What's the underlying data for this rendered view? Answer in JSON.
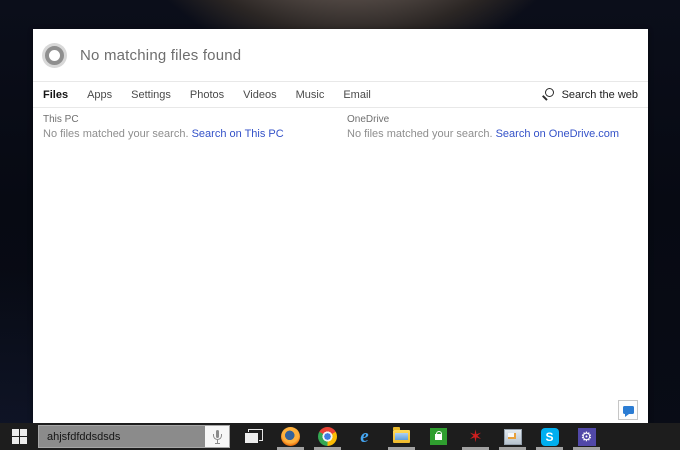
{
  "search_panel": {
    "status_text": "No matching files found",
    "tabs": [
      {
        "label": "Files",
        "active": true
      },
      {
        "label": "Apps",
        "active": false
      },
      {
        "label": "Settings",
        "active": false
      },
      {
        "label": "Photos",
        "active": false
      },
      {
        "label": "Videos",
        "active": false
      },
      {
        "label": "Music",
        "active": false
      },
      {
        "label": "Email",
        "active": false
      }
    ],
    "web_search_label": "Search the web",
    "result_groups": [
      {
        "source": "This PC",
        "message": "No files matched your search.",
        "link_label": "Search on This PC"
      },
      {
        "source": "OneDrive",
        "message": "No files matched your search.",
        "link_label": "Search on OneDrive.com"
      }
    ],
    "icons": {
      "cortana": "cortana-ring-icon",
      "web_search": "magnifier-icon",
      "feedback": "feedback-bubble-icon"
    }
  },
  "taskbar": {
    "search": {
      "value": "ahjsfdfddsdsds"
    },
    "start_icon": "windows-logo-icon",
    "mic_icon": "microphone-icon",
    "icons": [
      {
        "name": "task-view-icon",
        "running": false
      },
      {
        "name": "firefox-icon",
        "running": true
      },
      {
        "name": "chrome-icon",
        "running": true
      },
      {
        "name": "internet-explorer-icon",
        "glyph": "e",
        "running": false
      },
      {
        "name": "file-explorer-icon",
        "running": true
      },
      {
        "name": "store-icon",
        "running": false
      },
      {
        "name": "red-app-icon",
        "glyph": "✶",
        "running": true
      },
      {
        "name": "photo-viewer-icon",
        "running": true
      },
      {
        "name": "skype-icon",
        "glyph": "S",
        "running": true
      },
      {
        "name": "settings-icon",
        "glyph": "⚙",
        "running": true
      }
    ]
  },
  "colors": {
    "link_blue": "#3452c8",
    "feedback_blue": "#2b7cd3",
    "skype_blue": "#00aff0",
    "settings_purple": "#5148a8",
    "store_green": "#2f9e2f",
    "taskbar_dark": "#1d1d1d",
    "search_box_gray": "#8b8b8b",
    "panel_white": "#ffffff"
  }
}
